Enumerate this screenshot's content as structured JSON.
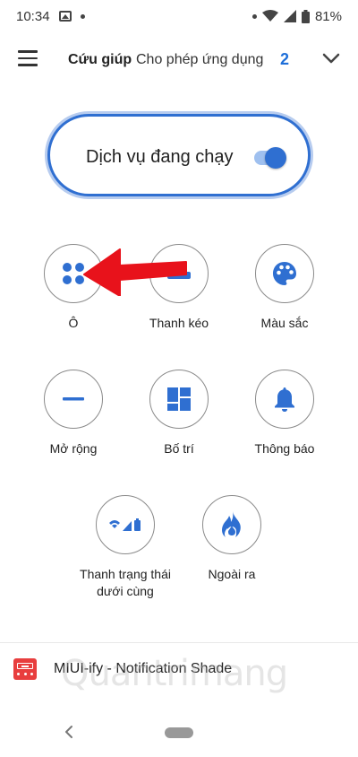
{
  "status_bar": {
    "time": "10:34",
    "battery": "81%"
  },
  "app_bar": {
    "tabs": [
      {
        "label": "Cứu giúp",
        "active": true
      },
      {
        "label": "Cho phép ứng dụng",
        "active": false
      }
    ],
    "count": "2",
    "accent": "#1e6fd9"
  },
  "service": {
    "label": "Dịch vụ đang chạy",
    "enabled": true
  },
  "options": [
    {
      "label": "Ô",
      "icon": "tiles-icon"
    },
    {
      "label": "Thanh kéo",
      "icon": "drag-bar-icon"
    },
    {
      "label": "Màu sắc",
      "icon": "palette-icon"
    },
    {
      "label": "Mở rộng",
      "icon": "expand-icon"
    },
    {
      "label": "Bố trí",
      "icon": "layout-icon"
    },
    {
      "label": "Thông báo",
      "icon": "bell-icon"
    },
    {
      "label": "Thanh trạng thái dưới cùng",
      "icon": "status-bar-icon"
    },
    {
      "label": "Ngoài ra",
      "icon": "flame-icon"
    }
  ],
  "bottom_card": {
    "title": "MIUI-ify - Notification Shade"
  },
  "watermark": "Quantrimang",
  "colors": {
    "primary": "#2f6fd1",
    "arrow": "#e8121b",
    "app_icon": "#e83e3e"
  }
}
